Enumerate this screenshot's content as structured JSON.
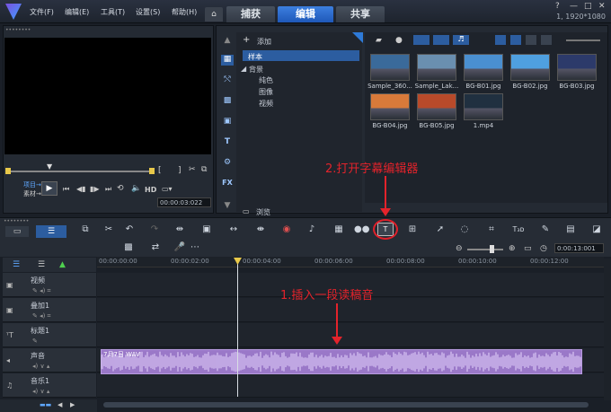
{
  "menu": [
    "文件(F)",
    "编辑(E)",
    "工具(T)",
    "设置(S)",
    "帮助(H)"
  ],
  "tabs": {
    "capture": "捕获",
    "edit": "编辑",
    "share": "共享"
  },
  "resolution": "1, 1920*1080",
  "preview": {
    "project_label": "项目→",
    "clip_label": "素材→",
    "hd": "HD",
    "timecode": "00:00:03:022"
  },
  "library": {
    "add_label": "添加",
    "tree": {
      "selected": "样本",
      "group": "背景",
      "children": [
        "纯色",
        "图像",
        "视频"
      ]
    },
    "browse_label": "浏览",
    "thumbnails": [
      {
        "label": "Sample_360...",
        "color": "#3a6a9a"
      },
      {
        "label": "Sample_Lak...",
        "color": "#6a8fb0"
      },
      {
        "label": "BG-B01.jpg",
        "color": "#4a8fd0"
      },
      {
        "label": "BG-B02.jpg",
        "color": "#4fa0e0"
      },
      {
        "label": "BG-B03.jpg",
        "color": "#2c3a6a"
      },
      {
        "label": "BG-B04.jpg",
        "color": "#d87a3a"
      },
      {
        "label": "BG-B05.jpg",
        "color": "#b84a2a"
      },
      {
        "label": "1.mp4",
        "color": "#203040"
      }
    ]
  },
  "toolbar": {
    "subtitle_btn": "T",
    "zoom_time": "0:00:13:001"
  },
  "ruler": [
    "00:00:00:00",
    "00:00:02:00",
    "00:00:04:00",
    "00:00:06:00",
    "00:00:08:00",
    "00:00:10:00",
    "00:00:12:00"
  ],
  "tracks": [
    {
      "name": "视频"
    },
    {
      "name": "叠加1"
    },
    {
      "name": "标题1"
    },
    {
      "name": "声音"
    },
    {
      "name": "音乐1"
    }
  ],
  "audio_clip": {
    "label": "7月7日 WAV"
  },
  "annotations": {
    "step1": "1.插入一段读稿音",
    "step2": "2.打开字幕编辑器"
  }
}
